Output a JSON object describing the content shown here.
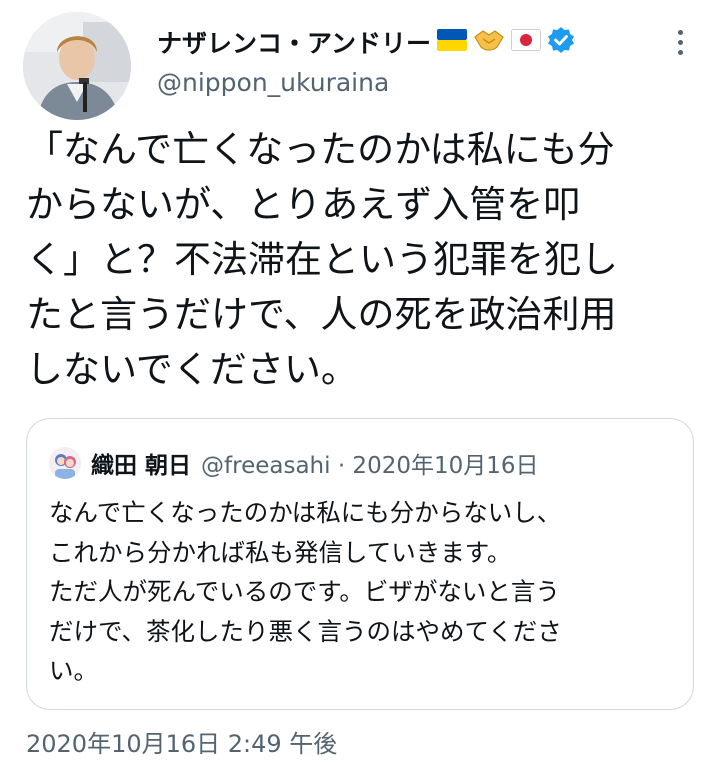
{
  "tweet": {
    "author": {
      "display_name": "ナザレンコ・アンドリー",
      "name_emojis": [
        "ukraine-flag-emoji",
        "handshake-emoji",
        "japan-flag-emoji"
      ],
      "verified_icon": "verified-badge-icon",
      "handle": "@nippon_ukuraina",
      "avatar_icon": "profile-photo"
    },
    "more_icon": "more-options-icon",
    "text_lines": [
      "「なんで亡くなったのかは私にも分",
      "からないが、とりあえず入管を叩",
      "く」と？不法滞在という犯罪を犯し",
      "たと言うだけで、人の死を政治利用",
      "しないでください。"
    ],
    "quote": {
      "avatar_icon": "quoted-user-avatar",
      "name": "織田 朝日",
      "handle_date": "@freeasahi · 2020年10月16日",
      "text_lines": [
        "なんで亡くなったのかは私にも分からないし、",
        "これから分かれば私も発信していきます。",
        "ただ人が死んでいるのです。ビザがないと言う",
        "だけで、茶化したり悪く言うのはやめてくださ",
        "い。"
      ]
    },
    "timestamp": "2020年10月16日 2:49 午後",
    "colors": {
      "text": "#0f1419",
      "secondary": "#536471",
      "verified": "#1d9bf0",
      "border": "#cfd9de"
    }
  }
}
